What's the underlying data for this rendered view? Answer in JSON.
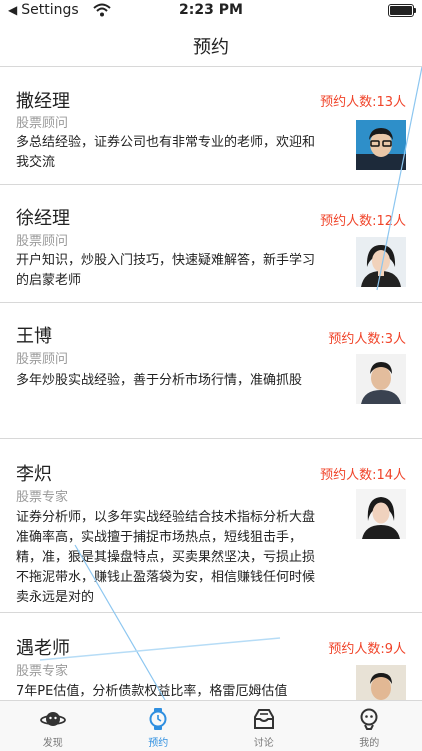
{
  "status_bar": {
    "back_app": "Settings",
    "time": "2:23 PM"
  },
  "nav": {
    "title": "预约"
  },
  "advisors": [
    {
      "name": "撒经理",
      "title": "股票顾问",
      "desc": "多总结经验，证券公司也有非常专业的老师，欢迎和我交流",
      "booked": "预约人数:13人"
    },
    {
      "name": "徐经理",
      "title": "股票顾问",
      "desc": "开户知识，炒股入门技巧，快速疑难解答，新手学习的启蒙老师",
      "booked": "预约人数:12人"
    },
    {
      "name": "王博",
      "title": "股票顾问",
      "desc": "多年炒股实战经验，善于分析市场行情，准确抓股",
      "booked": "预约人数:3人"
    },
    {
      "name": "李炽",
      "title": "股票专家",
      "desc": "证券分析师，以多年实战经验结合技术指标分析大盘准确率高，实战擅于捕捉市场热点，短线狙击手，精，准，狠是其操盘特点，买卖果然坚决，亏损止损不拖泥带水，赚钱止盈落袋为安，相信赚钱任何时候卖永远是对的",
      "booked": "预约人数:14人"
    },
    {
      "name": "遇老师",
      "title": "股票专家",
      "desc": "7年PE估值，分析债款权益比率，格雷厄姆估值",
      "booked": "预约人数:9人"
    }
  ],
  "tabs": [
    {
      "label": "发现",
      "icon": "planet-icon"
    },
    {
      "label": "预约",
      "icon": "watch-icon"
    },
    {
      "label": "讨论",
      "icon": "inbox-icon"
    },
    {
      "label": "我的",
      "icon": "profile-icon"
    }
  ],
  "colors": {
    "accent": "#2f8fe0",
    "booked_text": "#f0442a"
  },
  "active_tab": "预约"
}
